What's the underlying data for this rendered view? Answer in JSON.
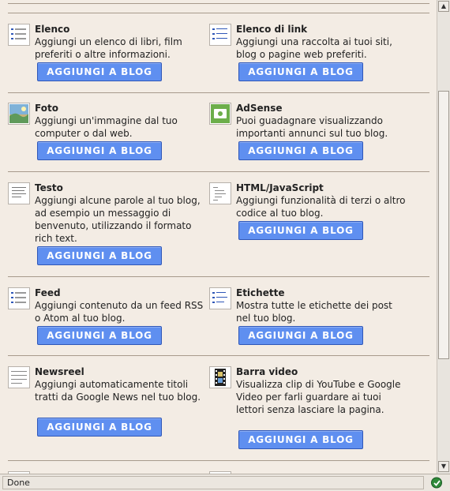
{
  "button_label": "AGGIUNGI A BLOG",
  "gadgets": [
    {
      "title": "Elenco",
      "desc": "Aggiungi un elenco di libri, film preferiti o altre informazioni.",
      "icon": "list-icon"
    },
    {
      "title": "Elenco di link",
      "desc": "Aggiungi una raccolta ai tuoi siti, blog o pagine web preferiti.",
      "icon": "link-list-icon"
    },
    {
      "title": "Foto",
      "desc": "Aggiungi un'immagine dal tuo computer o dal web.",
      "icon": "photo-icon"
    },
    {
      "title": "AdSense",
      "desc": "Puoi guadagnare visualizzando importanti annunci sul tuo blog.",
      "icon": "adsense-icon"
    },
    {
      "title": "Testo",
      "desc": "Aggiungi alcune parole al tuo blog, ad esempio un messaggio di benvenuto, utilizzando il formato rich text.",
      "icon": "text-icon"
    },
    {
      "title": "HTML/JavaScript",
      "desc": "Aggiungi funzionalità di terzi o altro codice al tuo blog.",
      "icon": "html-icon"
    },
    {
      "title": "Feed",
      "desc": "Aggiungi contenuto da un feed RSS o Atom al tuo blog.",
      "icon": "feed-icon"
    },
    {
      "title": "Etichette",
      "desc": "Mostra tutte le etichette dei post nel tuo blog.",
      "icon": "labels-icon"
    },
    {
      "title": "Newsreel",
      "desc": "Aggiungi automaticamente titoli tratti da Google News nel tuo blog.",
      "icon": "newsreel-icon"
    },
    {
      "title": "Barra video",
      "desc": "Visualizza clip di YouTube e Google Video per farli guardare ai tuoi lettori senza lasciare la pagina.",
      "icon": "video-bar-icon"
    }
  ],
  "partial_titles": [
    "",
    ""
  ],
  "status": {
    "text": "Done",
    "icon": "network-status-icon"
  },
  "colors": {
    "background": "#f3ece4",
    "button": "#5f8ff0",
    "button_border": "#2f57b8"
  }
}
